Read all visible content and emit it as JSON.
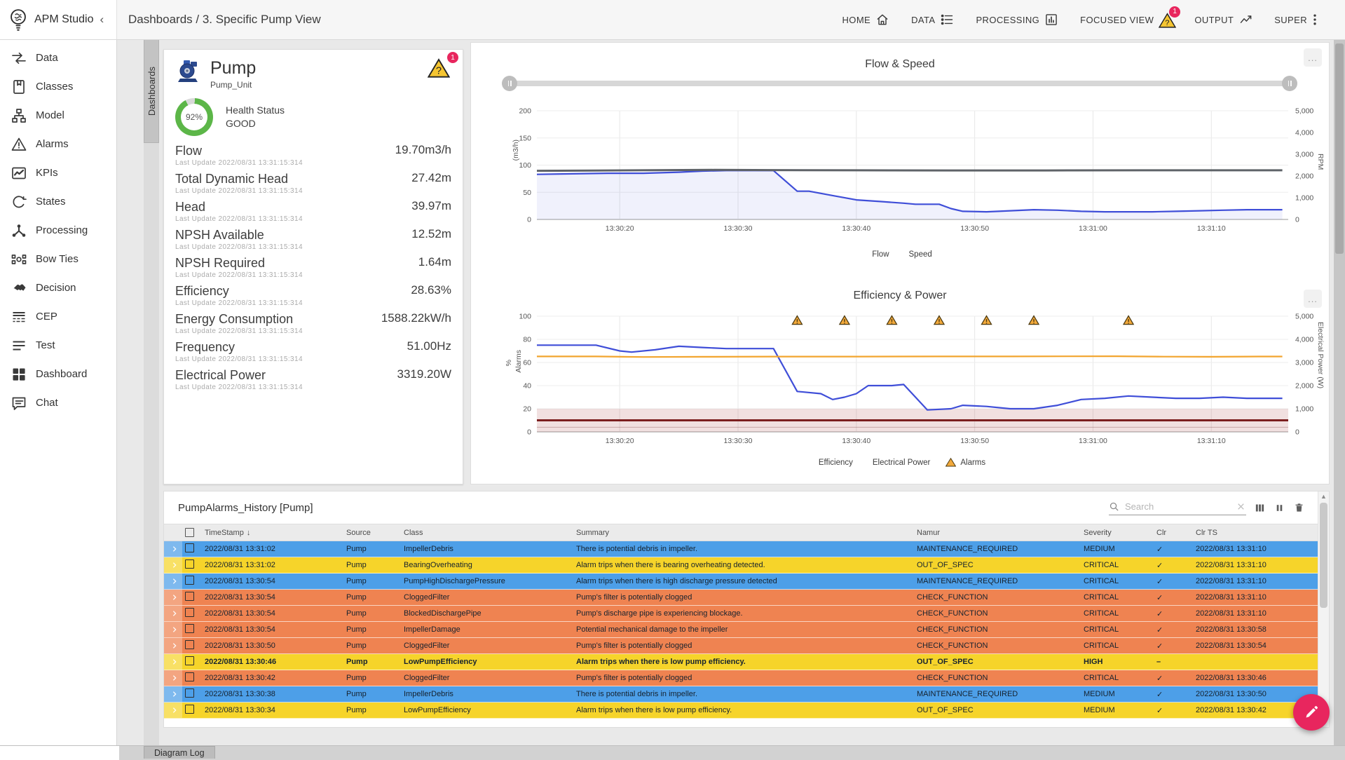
{
  "app": {
    "title": "APM Studio"
  },
  "breadcrumb": "Dashboards / 3. Specific Pump View",
  "nav": {
    "items": [
      {
        "label": "HOME",
        "icon": "home-icon"
      },
      {
        "label": "DATA",
        "icon": "list-icon"
      },
      {
        "label": "PROCESSING",
        "icon": "chart-box-icon"
      },
      {
        "label": "FOCUSED VIEW",
        "icon": "warning-triangle-icon",
        "badge": "1"
      },
      {
        "label": "OUTPUT",
        "icon": "activity-icon"
      },
      {
        "label": "SUPER",
        "icon": "kebab-icon"
      }
    ]
  },
  "sidebar": {
    "items": [
      {
        "label": "Data",
        "icon": "data-flow-icon"
      },
      {
        "label": "Classes",
        "icon": "book-icon"
      },
      {
        "label": "Model",
        "icon": "hierarchy-icon"
      },
      {
        "label": "Alarms",
        "icon": "alarm-triangle-icon"
      },
      {
        "label": "KPIs",
        "icon": "kpi-chart-icon"
      },
      {
        "label": "States",
        "icon": "state-loop-icon"
      },
      {
        "label": "Processing",
        "icon": "network-icon"
      },
      {
        "label": "Bow Ties",
        "icon": "bowtie-icon"
      },
      {
        "label": "Decision",
        "icon": "handshake-icon"
      },
      {
        "label": "CEP",
        "icon": "cep-rows-icon"
      },
      {
        "label": "Test",
        "icon": "test-lines-icon"
      },
      {
        "label": "Dashboard",
        "icon": "dashboard-grid-icon"
      },
      {
        "label": "Chat",
        "icon": "chat-bubble-icon"
      }
    ]
  },
  "dashboards_tab": "Dashboards",
  "pump_card": {
    "title": "Pump",
    "subtitle": "Pump_Unit",
    "alert_badge": "1",
    "health": {
      "percent": "92%",
      "label": "Health Status",
      "status": "GOOD"
    },
    "metrics": [
      {
        "label": "Flow",
        "value": "19.70m3/h",
        "updated": "Last Update 2022/08/31 13:31:15:314"
      },
      {
        "label": "Total Dynamic Head",
        "value": "27.42m",
        "updated": "Last Update 2022/08/31 13:31:15:314"
      },
      {
        "label": "Head",
        "value": "39.97m",
        "updated": "Last Update 2022/08/31 13:31:15:314"
      },
      {
        "label": "NPSH Available",
        "value": "12.52m",
        "updated": "Last Update 2022/08/31 13:31:15:314"
      },
      {
        "label": "NPSH Required",
        "value": "1.64m",
        "updated": "Last Update 2022/08/31 13:31:15:314"
      },
      {
        "label": "Efficiency",
        "value": "28.63%",
        "updated": "Last Update 2022/08/31 13:31:15:314"
      },
      {
        "label": "Energy Consumption",
        "value": "1588.22kW/h",
        "updated": "Last Update 2022/08/31 13:31:15:314"
      },
      {
        "label": "Frequency",
        "value": "51.00Hz",
        "updated": "Last Update 2022/08/31 13:31:15:314"
      },
      {
        "label": "Electrical Power",
        "value": "3319.20W",
        "updated": "Last Update 2022/08/31 13:31:15:314"
      }
    ]
  },
  "chart_data": [
    {
      "type": "line",
      "title": "Flow & Speed",
      "xlim": [
        13,
        76.5
      ],
      "x_ticks": [
        {
          "t": 20,
          "label": "13:30:20"
        },
        {
          "t": 30,
          "label": "13:30:30"
        },
        {
          "t": 40,
          "label": "13:30:40"
        },
        {
          "t": 50,
          "label": "13:30:50"
        },
        {
          "t": 60,
          "label": "13:31:00"
        },
        {
          "t": 70,
          "label": "13:31:10"
        }
      ],
      "left_axis": {
        "label": "(m3/h)",
        "lim": [
          0,
          200
        ],
        "ticks": [
          0,
          50,
          100,
          150,
          200
        ]
      },
      "right_axis": {
        "label": "RPM",
        "lim": [
          0,
          5000
        ],
        "tick_labels": [
          "0",
          "1,000",
          "2,000",
          "3,000",
          "4,000",
          "5,000"
        ]
      },
      "series": [
        {
          "name": "Flow",
          "color": "#3f4ed8",
          "axis": "left",
          "area": true,
          "points": [
            [
              13,
              83
            ],
            [
              16,
              84
            ],
            [
              19,
              85
            ],
            [
              22,
              85
            ],
            [
              25,
              87
            ],
            [
              27,
              89
            ],
            [
              29,
              90
            ],
            [
              31,
              90
            ],
            [
              33,
              90
            ],
            [
              35,
              52
            ],
            [
              36,
              52
            ],
            [
              38,
              44
            ],
            [
              40,
              36
            ],
            [
              42,
              33
            ],
            [
              44,
              30
            ],
            [
              45,
              28
            ],
            [
              47,
              28
            ],
            [
              48,
              20
            ],
            [
              49,
              15
            ],
            [
              51,
              14
            ],
            [
              53,
              16
            ],
            [
              55,
              18
            ],
            [
              57,
              17
            ],
            [
              59,
              15
            ],
            [
              61,
              14
            ],
            [
              63,
              14
            ],
            [
              65,
              14
            ],
            [
              67,
              15
            ],
            [
              69,
              16
            ],
            [
              71,
              17
            ],
            [
              73,
              18
            ],
            [
              76,
              18
            ]
          ]
        },
        {
          "name": "Speed",
          "color": "#5f6368",
          "axis": "right",
          "points": [
            [
              13,
              2240
            ],
            [
              18,
              2250
            ],
            [
              24,
              2270
            ],
            [
              28,
              2280
            ],
            [
              33,
              2270
            ],
            [
              40,
              2260
            ],
            [
              48,
              2255
            ],
            [
              56,
              2255
            ],
            [
              64,
              2260
            ],
            [
              70,
              2260
            ],
            [
              76,
              2260
            ]
          ]
        }
      ],
      "legend": [
        {
          "label": "Flow",
          "swatch": "area-line",
          "color": "#3f4ed8"
        },
        {
          "label": "Speed",
          "swatch": "line",
          "color": "#5f6368"
        }
      ]
    },
    {
      "type": "line",
      "title": "Efficiency & Power",
      "xlim": [
        13,
        76.5
      ],
      "x_ticks": [
        {
          "t": 20,
          "label": "13:30:20"
        },
        {
          "t": 30,
          "label": "13:30:30"
        },
        {
          "t": 40,
          "label": "13:30:40"
        },
        {
          "t": 50,
          "label": "13:30:50"
        },
        {
          "t": 60,
          "label": "13:31:00"
        },
        {
          "t": 70,
          "label": "13:31:10"
        }
      ],
      "left_axis": {
        "label": "%",
        "label2": "Alarms",
        "lim": [
          0,
          100
        ],
        "ticks": [
          0,
          20,
          40,
          60,
          80,
          100
        ]
      },
      "right_axis": {
        "label": "Electrical Power (W)",
        "lim": [
          0,
          5000
        ],
        "tick_labels": [
          "0",
          "1,000",
          "2,000",
          "3,000",
          "4,000",
          "5,000"
        ]
      },
      "series": [
        {
          "name": "Efficiency",
          "color": "#3f4ed8",
          "axis": "left",
          "points": [
            [
              13,
              75
            ],
            [
              16,
              75
            ],
            [
              18,
              75
            ],
            [
              20,
              70
            ],
            [
              21,
              69
            ],
            [
              23,
              71
            ],
            [
              25,
              74
            ],
            [
              27,
              73
            ],
            [
              29,
              72
            ],
            [
              31,
              72
            ],
            [
              33,
              72
            ],
            [
              35,
              35
            ],
            [
              37,
              33
            ],
            [
              38,
              28
            ],
            [
              39,
              30
            ],
            [
              40,
              33
            ],
            [
              41,
              40
            ],
            [
              43,
              40
            ],
            [
              44,
              41
            ],
            [
              45,
              30
            ],
            [
              46,
              19
            ],
            [
              48,
              20
            ],
            [
              49,
              23
            ],
            [
              51,
              22
            ],
            [
              53,
              20
            ],
            [
              55,
              20
            ],
            [
              57,
              23
            ],
            [
              59,
              28
            ],
            [
              61,
              29
            ],
            [
              63,
              31
            ],
            [
              65,
              30
            ],
            [
              67,
              29
            ],
            [
              69,
              29
            ],
            [
              71,
              30
            ],
            [
              73,
              29
            ],
            [
              76,
              29
            ]
          ]
        },
        {
          "name": "Electrical Power",
          "color": "#f2a52f",
          "axis": "right",
          "points": [
            [
              13,
              3260
            ],
            [
              18,
              3260
            ],
            [
              22,
              3235
            ],
            [
              27,
              3245
            ],
            [
              33,
              3255
            ],
            [
              40,
              3255
            ],
            [
              47,
              3260
            ],
            [
              53,
              3260
            ],
            [
              58,
              3268
            ],
            [
              62,
              3270
            ],
            [
              66,
              3252
            ],
            [
              70,
              3246
            ],
            [
              74,
              3258
            ],
            [
              76,
              3258
            ]
          ]
        }
      ],
      "alarms": {
        "times": [
          35,
          39,
          43,
          47,
          51,
          55,
          63
        ],
        "y": 96
      },
      "threshold_band": {
        "from": 0,
        "to": 20,
        "line": 10
      },
      "legend": [
        {
          "label": "Efficiency",
          "swatch": "line",
          "color": "#3f4ed8"
        },
        {
          "label": "Electrical Power",
          "swatch": "line",
          "color": "#f2a52f"
        },
        {
          "label": "Alarms",
          "swatch": "triangle",
          "color": "#f2a93b"
        }
      ]
    }
  ],
  "table": {
    "title": "PumpAlarms_History [Pump]",
    "search_placeholder": "Search",
    "columns": [
      "TimeStamp",
      "Source",
      "Class",
      "Summary",
      "Namur",
      "Severity",
      "Clr",
      "Clr TS"
    ],
    "rows": [
      {
        "ts": "2022/08/31 13:31:02",
        "source": "Pump",
        "cls": "ImpellerDebris",
        "summary": "There is potential debris in impeller.",
        "namur": "MAINTENANCE_REQUIRED",
        "severity": "MEDIUM",
        "clr": "check",
        "clr_ts": "2022/08/31 13:31:10",
        "color": "blue",
        "bold": false
      },
      {
        "ts": "2022/08/31 13:31:02",
        "source": "Pump",
        "cls": "BearingOverheating",
        "summary": "Alarm trips when there is bearing overheating detected.",
        "namur": "OUT_OF_SPEC",
        "severity": "CRITICAL",
        "clr": "check",
        "clr_ts": "2022/08/31 13:31:10",
        "color": "yellow",
        "bold": false
      },
      {
        "ts": "2022/08/31 13:30:54",
        "source": "Pump",
        "cls": "PumpHighDischargePressure",
        "summary": "Alarm trips when there is high discharge pressure detected",
        "namur": "MAINTENANCE_REQUIRED",
        "severity": "CRITICAL",
        "clr": "check",
        "clr_ts": "2022/08/31 13:31:10",
        "color": "blue",
        "bold": false
      },
      {
        "ts": "2022/08/31 13:30:54",
        "source": "Pump",
        "cls": "CloggedFilter",
        "summary": "Pump's filter is potentially clogged",
        "namur": "CHECK_FUNCTION",
        "severity": "CRITICAL",
        "clr": "check",
        "clr_ts": "2022/08/31 13:31:10",
        "color": "orange",
        "bold": false
      },
      {
        "ts": "2022/08/31 13:30:54",
        "source": "Pump",
        "cls": "BlockedDischargePipe",
        "summary": "Pump's discharge pipe is experiencing blockage.",
        "namur": "CHECK_FUNCTION",
        "severity": "CRITICAL",
        "clr": "check",
        "clr_ts": "2022/08/31 13:31:10",
        "color": "orange",
        "bold": false
      },
      {
        "ts": "2022/08/31 13:30:54",
        "source": "Pump",
        "cls": "ImpellerDamage",
        "summary": "Potential mechanical damage to the impeller",
        "namur": "CHECK_FUNCTION",
        "severity": "CRITICAL",
        "clr": "check",
        "clr_ts": "2022/08/31 13:30:58",
        "color": "orange",
        "bold": false
      },
      {
        "ts": "2022/08/31 13:30:50",
        "source": "Pump",
        "cls": "CloggedFilter",
        "summary": "Pump's filter is potentially clogged",
        "namur": "CHECK_FUNCTION",
        "severity": "CRITICAL",
        "clr": "check",
        "clr_ts": "2022/08/31 13:30:54",
        "color": "orange",
        "bold": false
      },
      {
        "ts": "2022/08/31 13:30:46",
        "source": "Pump",
        "cls": "LowPumpEfficiency",
        "summary": "Alarm trips when there is low pump efficiency.",
        "namur": "OUT_OF_SPEC",
        "severity": "HIGH",
        "clr": "dash",
        "clr_ts": "",
        "color": "yellow",
        "bold": true
      },
      {
        "ts": "2022/08/31 13:30:42",
        "source": "Pump",
        "cls": "CloggedFilter",
        "summary": "Pump's filter is potentially clogged",
        "namur": "CHECK_FUNCTION",
        "severity": "CRITICAL",
        "clr": "check",
        "clr_ts": "2022/08/31 13:30:46",
        "color": "orange",
        "bold": false
      },
      {
        "ts": "2022/08/31 13:30:38",
        "source": "Pump",
        "cls": "ImpellerDebris",
        "summary": "There is potential debris in impeller.",
        "namur": "MAINTENANCE_REQUIRED",
        "severity": "MEDIUM",
        "clr": "check",
        "clr_ts": "2022/08/31 13:30:50",
        "color": "blue",
        "bold": false
      },
      {
        "ts": "2022/08/31 13:30:34",
        "source": "Pump",
        "cls": "LowPumpEfficiency",
        "summary": "Alarm trips when there is low pump efficiency.",
        "namur": "OUT_OF_SPEC",
        "severity": "MEDIUM",
        "clr": "check",
        "clr_ts": "2022/08/31 13:30:42",
        "color": "yellow",
        "bold": false
      }
    ]
  },
  "footer": {
    "tab": "Diagram Log"
  }
}
